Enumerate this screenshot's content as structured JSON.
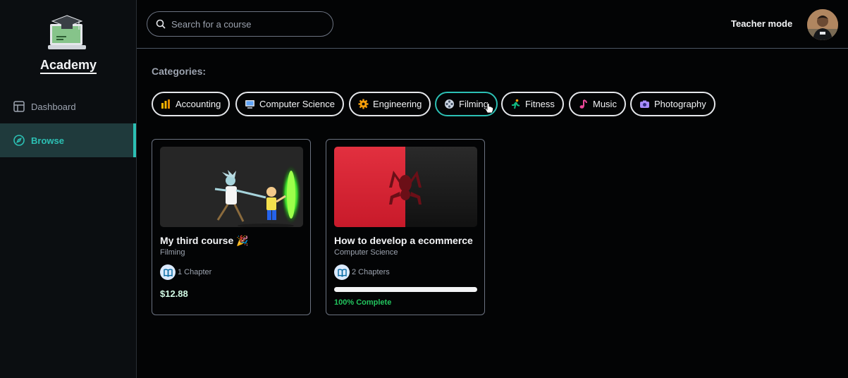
{
  "sidebar": {
    "brand": "Academy",
    "logo_icon": "graduation-laptop-icon",
    "items": [
      {
        "label": "Dashboard",
        "icon": "layout-icon",
        "active": false
      },
      {
        "label": "Browse",
        "icon": "compass-icon",
        "active": true
      }
    ]
  },
  "topbar": {
    "search_placeholder": "Search for a course",
    "teacher_mode": "Teacher mode"
  },
  "categories": {
    "title": "Categories:",
    "items": [
      {
        "label": "Accounting",
        "icon": "bar-chart-emoji-icon"
      },
      {
        "label": "Computer Science",
        "icon": "computer-emoji-icon"
      },
      {
        "label": "Engineering",
        "icon": "gear-emoji-icon"
      },
      {
        "label": "Filming",
        "icon": "film-reel-emoji-icon",
        "active": true
      },
      {
        "label": "Fitness",
        "icon": "runner-emoji-icon"
      },
      {
        "label": "Music",
        "icon": "music-note-emoji-icon"
      },
      {
        "label": "Photography",
        "icon": "camera-emoji-icon"
      }
    ]
  },
  "courses": [
    {
      "title": "My third course 🎉",
      "category": "Filming",
      "chapters": "1 Chapter",
      "price": "$12.88"
    },
    {
      "title": "How to develop a ecommerce",
      "category": "Computer Science",
      "chapters": "2 Chapters",
      "progress": 100,
      "progress_label": "100% Complete"
    }
  ],
  "colors": {
    "accent": "#2cc0b4",
    "complete": "#22c55e",
    "background": "#030405"
  }
}
